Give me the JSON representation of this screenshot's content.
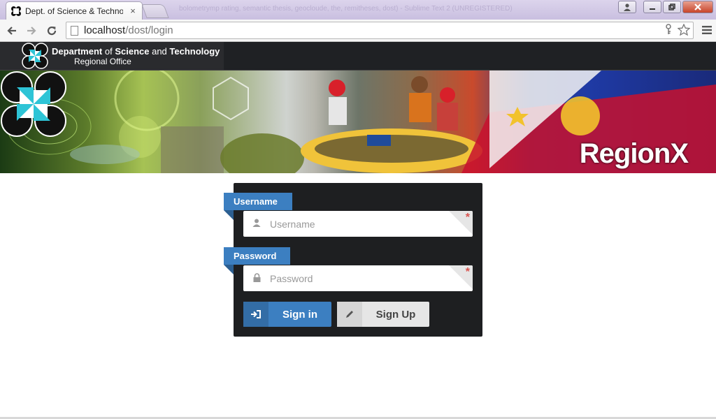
{
  "browser": {
    "tab_title": "Dept. of Science & Technology",
    "window_title_faint": "bolometrymp rating, semantic thesis, geocloude, the, remitheses, dost) - Sublime Text 2 (UNREGISTERED)",
    "url_host": "localhost",
    "url_path": "/dost/login",
    "close_tab_glyph": "×"
  },
  "header": {
    "brand_bold1": "Department",
    "brand_of": " of ",
    "brand_bold2": "Science",
    "brand_and": " and ",
    "brand_bold3": "Technology",
    "brand_sub": "Regional Office"
  },
  "banner": {
    "region_text": "RegionX"
  },
  "login": {
    "username_label": "Username",
    "username_placeholder": "Username",
    "username_value": "",
    "password_label": "Password",
    "password_placeholder": "Password",
    "password_value": "",
    "required_mark": "*",
    "signin_label": "Sign in",
    "signup_label": "Sign Up"
  },
  "colors": {
    "accent": "#3c7fc1",
    "card_bg": "#1e1f21",
    "required": "#d9534f"
  },
  "icons": {
    "username_field": "user-icon",
    "password_field": "lock-icon",
    "signin": "sign-in-icon",
    "signup": "pencil-icon"
  }
}
